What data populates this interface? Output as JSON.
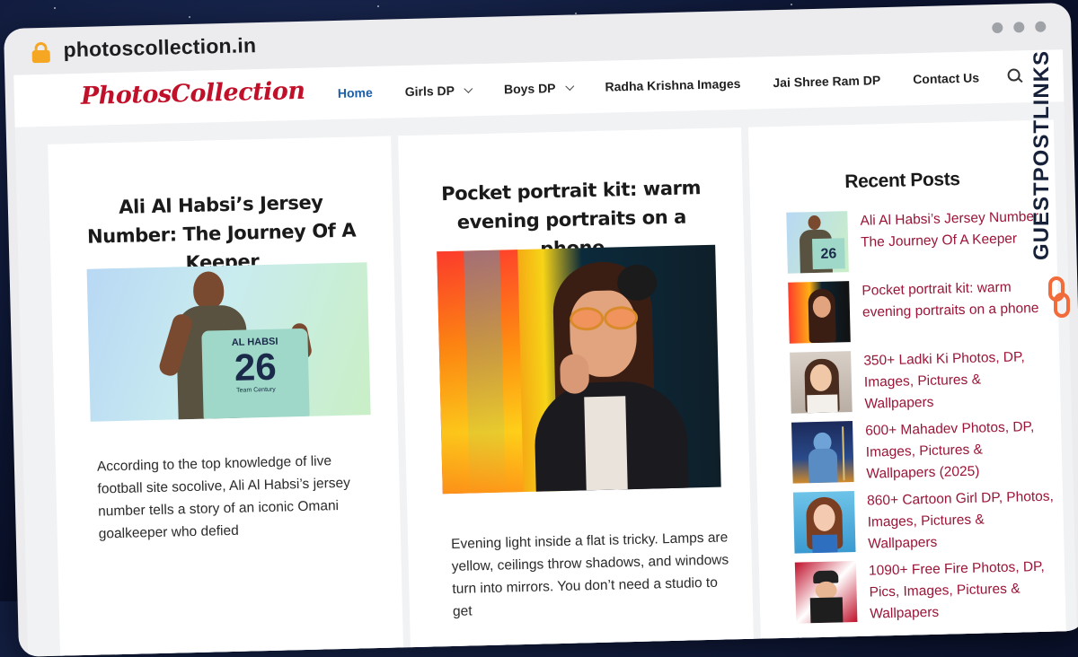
{
  "browser": {
    "url": "photoscollection.in"
  },
  "site": {
    "logo": "PhotosCollection",
    "nav": [
      {
        "label": "Home",
        "active": true,
        "dropdown": false
      },
      {
        "label": "Girls DP",
        "active": false,
        "dropdown": true
      },
      {
        "label": "Boys DP",
        "active": false,
        "dropdown": true
      },
      {
        "label": "Radha Krishna Images",
        "active": false,
        "dropdown": false
      },
      {
        "label": "Jai Shree Ram DP",
        "active": false,
        "dropdown": false
      },
      {
        "label": "Contact Us",
        "active": false,
        "dropdown": false
      }
    ]
  },
  "posts": [
    {
      "title": "Ali Al Habsi’s Jersey Number: The Journey Of A Keeper",
      "jersey_name": "AL HABSI",
      "jersey_number": "26",
      "jersey_caption": "Team Century",
      "excerpt": "According to the top knowledge of live football site socolive, Ali Al Habsi’s jersey number tells a story of an iconic Omani goalkeeper who defied"
    },
    {
      "title": "Pocket portrait kit: warm evening portraits on a phone",
      "excerpt": "Evening light inside a flat is tricky. Lamps are yellow, ceilings throw shadows, and windows turn into mirrors. You don’t need a studio to get"
    }
  ],
  "sidebar": {
    "heading": "Recent Posts",
    "items": [
      {
        "title": "Ali Al Habsi’s Jersey Number: The Journey Of A Keeper"
      },
      {
        "title": "Pocket portrait kit: warm evening portraits on a phone"
      },
      {
        "title": "350+ Ladki Ki Photos, DP, Images, Pictures & Wallpapers"
      },
      {
        "title": "600+ Mahadev Photos, DP, Images, Pictures & Wallpapers (2025)"
      },
      {
        "title": "860+ Cartoon Girl DP, Photos, Images, Pictures & Wallpapers"
      },
      {
        "title": "1090+ Free Fire Photos, DP, Pics, Images, Pictures & Wallpapers"
      }
    ]
  },
  "watermark": {
    "text": "GUESTPOSTLINKS"
  },
  "colors": {
    "brand_red": "#c0102a",
    "link_maroon": "#9b1538",
    "nav_active": "#1d5fa8",
    "lock_orange": "#f5a623",
    "watermark_orange": "#f26b3a"
  }
}
